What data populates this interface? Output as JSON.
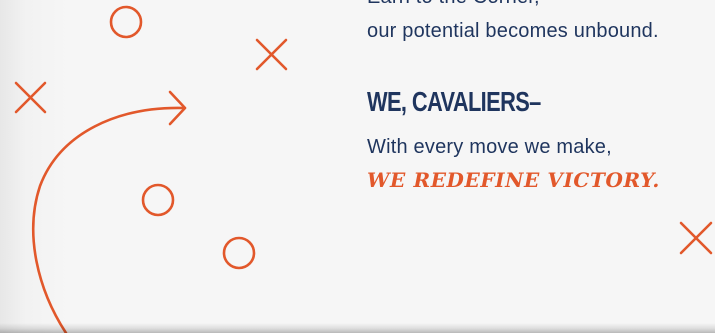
{
  "copy": {
    "cut_line": "Earn to the Corner,",
    "line_1": "our potential becomes unbound.",
    "heading": "WE, CAVALIERS–",
    "line_2": "With every move we make,",
    "emphasis": "WE REDEFINE VICTORY."
  },
  "colors": {
    "background": "#f6f6f6",
    "text_navy": "#1f355e",
    "accent_orange": "#e2582b"
  },
  "decor": {
    "icons": [
      "circle-icon",
      "x-mark-icon",
      "curved-arrow-icon"
    ]
  }
}
